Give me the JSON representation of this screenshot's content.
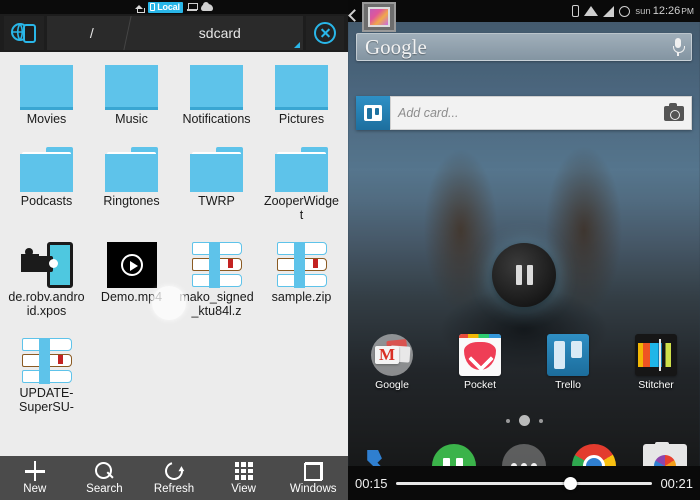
{
  "left_panel": {
    "status_bar": {
      "home_icon": "home-icon",
      "connection_badge": "Local",
      "pc_icon": "computer-icon",
      "cloud_icon": "cloud-icon"
    },
    "address_bar": {
      "device_icon": "device-globe-icon",
      "segments": [
        "/",
        "sdcard"
      ],
      "close_label": "close-icon"
    },
    "files": [
      {
        "name": "Movies",
        "type": "folder-flat"
      },
      {
        "name": "Music",
        "type": "folder-flat"
      },
      {
        "name": "Notifications",
        "type": "folder-flat"
      },
      {
        "name": "Pictures",
        "type": "folder-flat"
      },
      {
        "name": "Podcasts",
        "type": "folder"
      },
      {
        "name": "Ringtones",
        "type": "folder"
      },
      {
        "name": "TWRP",
        "type": "folder"
      },
      {
        "name": "ZooperWidget",
        "type": "folder"
      },
      {
        "name": "de.robv.android.xpos",
        "type": "apk"
      },
      {
        "name": "Demo.mp4",
        "type": "video"
      },
      {
        "name": "mako_signed_ktu84l.z",
        "type": "archive"
      },
      {
        "name": "sample.zip",
        "type": "archive"
      },
      {
        "name": "UPDATE-SuperSU-",
        "type": "archive"
      }
    ],
    "toolbar": [
      {
        "label": "New",
        "icon": "plus-icon"
      },
      {
        "label": "Search",
        "icon": "search-icon"
      },
      {
        "label": "Refresh",
        "icon": "refresh-icon"
      },
      {
        "label": "View",
        "icon": "grid-icon"
      },
      {
        "label": "Windows",
        "icon": "windows-icon"
      }
    ]
  },
  "right_panel": {
    "status_bar": {
      "bluetooth_icon": "bluetooth-icon",
      "wifi_icon": "wifi-icon",
      "signal_icon": "signal-icon",
      "alarm_icon": "alarm-icon",
      "weekday": "sun",
      "time": "12:26",
      "meridiem": "PM"
    },
    "gallery_icon": "gallery-icon",
    "back_icon": "back-chevron-icon",
    "search_widget": {
      "text": "Google",
      "mic_icon": "microphone-icon"
    },
    "trello_widget": {
      "logo_icon": "trello-logo-icon",
      "placeholder": "Add card...",
      "camera_icon": "camera-icon"
    },
    "pause_button": "pause-icon",
    "apps": [
      {
        "label": "Google",
        "icon": "google-folder-icon"
      },
      {
        "label": "Pocket",
        "icon": "pocket-icon"
      },
      {
        "label": "Trello",
        "icon": "trello-icon"
      },
      {
        "label": "Stitcher",
        "icon": "stitcher-icon"
      }
    ],
    "page_dots": {
      "count": 3,
      "active_index": 1
    },
    "dock": [
      {
        "icon": "phone-icon"
      },
      {
        "icon": "hangouts-icon"
      },
      {
        "icon": "app-drawer-icon"
      },
      {
        "icon": "chrome-icon"
      },
      {
        "icon": "camera-app-icon"
      }
    ],
    "scrubber": {
      "current_time": "00:15",
      "total_time": "00:21",
      "progress_percent": 68
    }
  },
  "colors": {
    "accent_cyan": "#29b6e8",
    "folder_blue": "#5ec3ea",
    "toolbar_gray": "#4b4b4b",
    "panel_bg": "#ececec"
  }
}
